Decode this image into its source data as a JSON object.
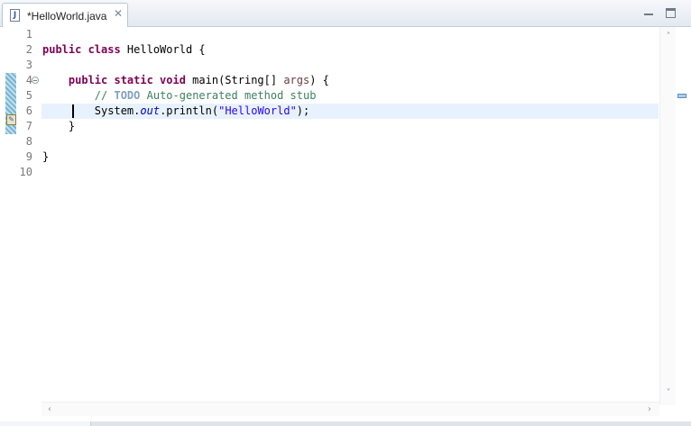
{
  "tab": {
    "file_icon_glyph": "J",
    "title": "*HelloWorld.java",
    "close_glyph": "✕"
  },
  "editor": {
    "line_numbers": [
      "1",
      "2",
      "3",
      "4",
      "5",
      "6",
      "7",
      "8",
      "9",
      "10"
    ],
    "current_line": 6,
    "code": {
      "l2_kw": "public class",
      "l2_rest": " HelloWorld {",
      "l4_indent": "    ",
      "l4_kw": "public static void",
      "l4_mid": " main(String[] ",
      "l4_param": "args",
      "l4_end": ") {",
      "l5_indent": "        ",
      "l5_comment_start": "// ",
      "l5_todo": "TODO",
      "l5_comment_rest": " Auto-generated method stub",
      "l6_indent": "        ",
      "l6_a": "System.",
      "l6_field": "out",
      "l6_b": ".println(",
      "l6_str": "\"HelloWorld\"",
      "l6_c": ");",
      "l7": "    }",
      "l9": "}"
    }
  },
  "icons": {
    "task_glyph": "✎",
    "scroll_up": "˄",
    "scroll_down": "˅",
    "scroll_left": "‹",
    "scroll_right": "›"
  },
  "colors": {
    "keyword": "#7f0055",
    "comment": "#3f7f5f",
    "string": "#2a00ff",
    "field": "#0000c0",
    "current_line_bg": "#e8f2fe"
  }
}
